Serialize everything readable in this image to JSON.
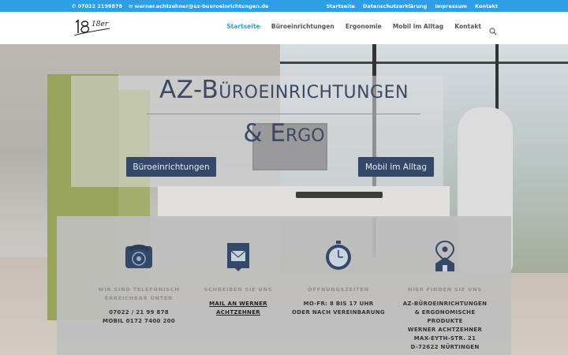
{
  "topbar": {
    "phone": "07022 2199878",
    "email": "werner.achtzehner@az-bueroeinrichtungen.de",
    "links": [
      "Startseite",
      "Datenschutzerklärung",
      "Impressum",
      "Kontakt"
    ]
  },
  "header": {
    "logo_text": "18er",
    "nav": [
      "Startseite",
      "Büroeinrichtungen",
      "Ergonomie",
      "Mobil im Alltag",
      "Kontakt"
    ]
  },
  "hero": {
    "title_line1": "AZ-Büroeinrichtungen",
    "title_line2": "& Ergo",
    "button1": "Büroeinrichtungen",
    "button2": "Mobil im Alltag"
  },
  "info": {
    "phone": {
      "caption": "WIR SIND TELEFONISCH ERREICHBAR UNTER",
      "line1": "07022 / 21 99 878",
      "line2": "MOBIL 0172  7400 200"
    },
    "mail": {
      "caption": "SCHREIBEN SIE UNS",
      "link": "MAIL AN WERNER ACHTZEHNER"
    },
    "hours": {
      "caption": "ÖFFNUNGSZEITEN",
      "line1": "MO-FR: 8 BIS 17 UHR",
      "line2": "ODER NACH VEREINBARUNG"
    },
    "location": {
      "caption": "HIER FINDEN SIE UNS",
      "line1": "AZ-BÜROEINRICHTUNGEN",
      "line2": "& ERGONOMISCHE PRODUKTE",
      "line3": "WERNER ACHTZEHNER",
      "line4": "MAX-EYTH-STR. 21",
      "line5": "D-72622 NÜRTINGEN"
    }
  },
  "colors": {
    "topbar": "#2e9fe6",
    "accent": "#2e9fe6",
    "button": "#34496a",
    "title": "#3b4a63"
  }
}
